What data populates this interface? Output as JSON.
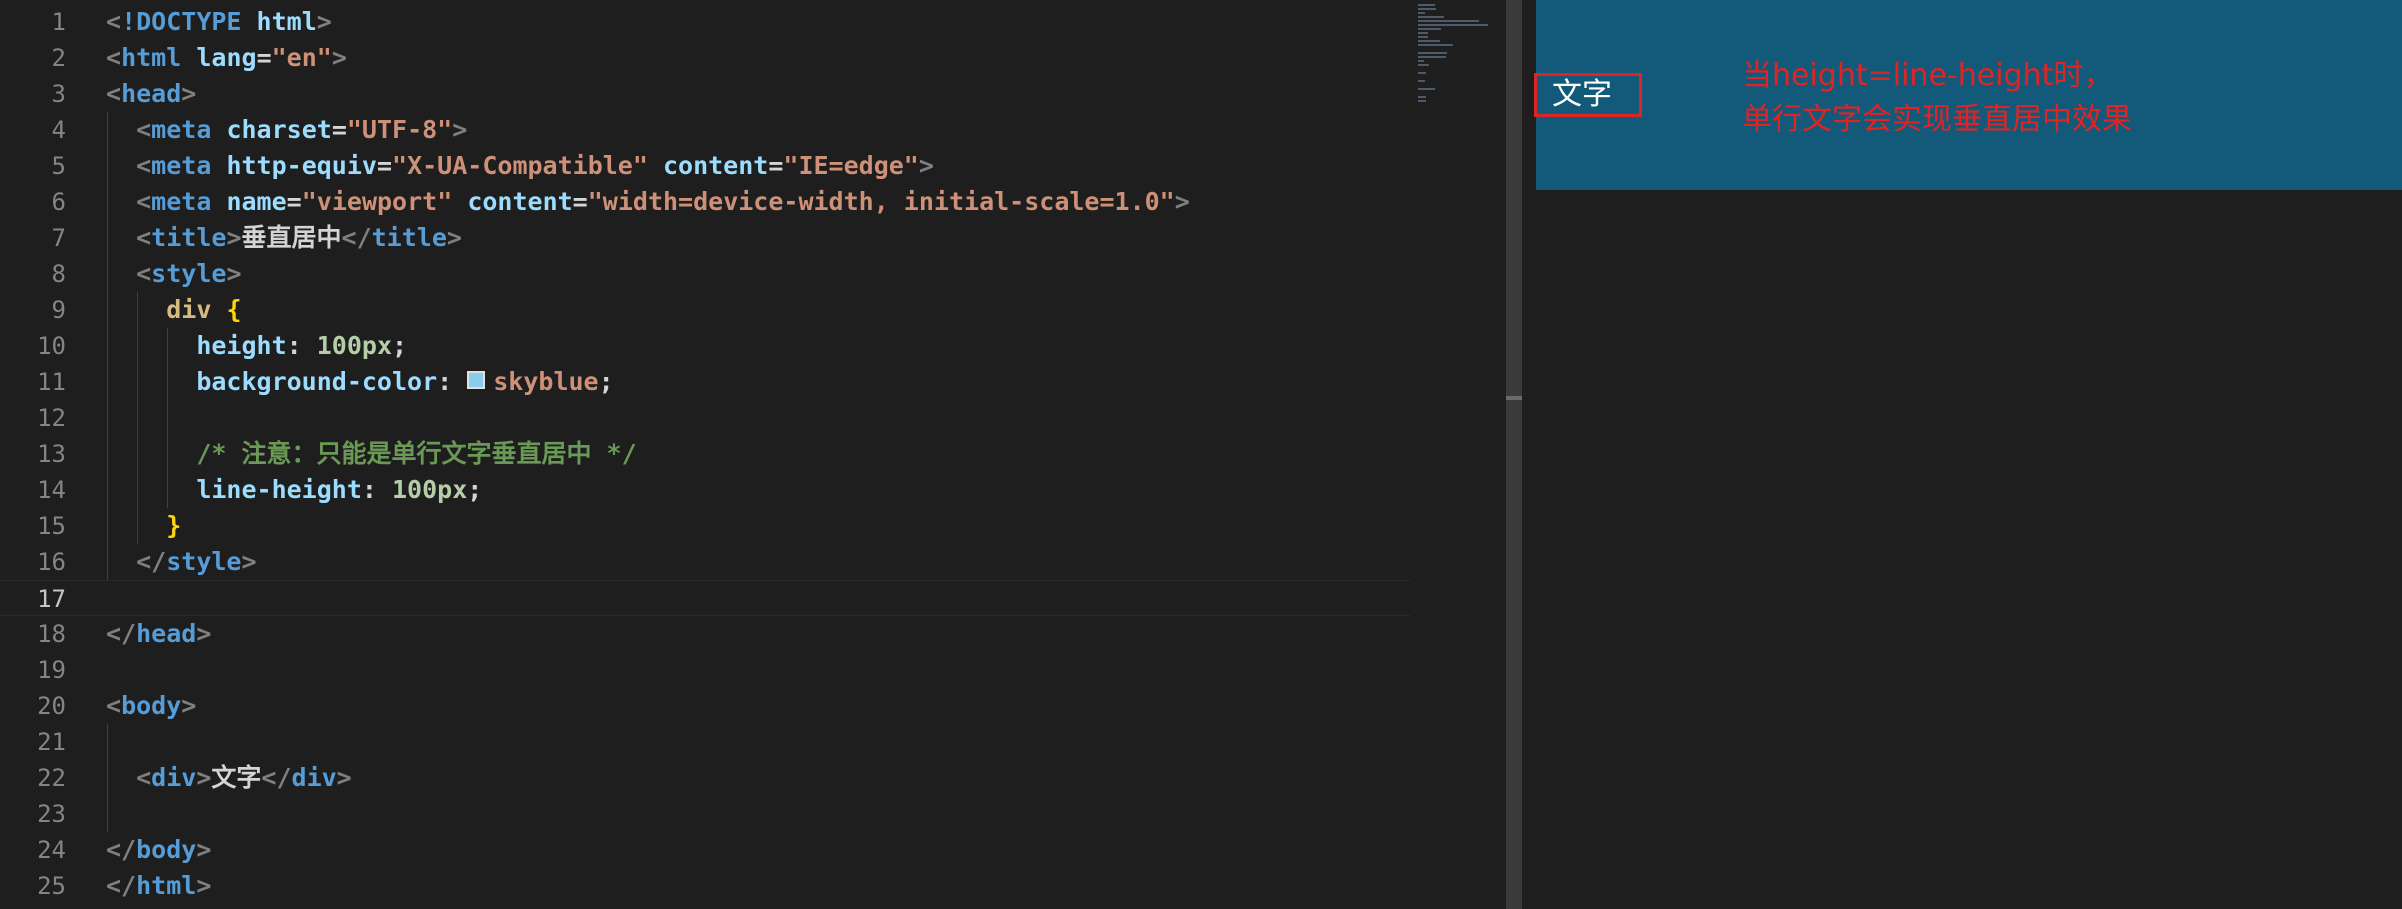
{
  "editor": {
    "line_numbers": [
      "1",
      "2",
      "3",
      "4",
      "5",
      "6",
      "7",
      "8",
      "9",
      "10",
      "11",
      "12",
      "13",
      "14",
      "15",
      "16",
      "17",
      "18",
      "19",
      "20",
      "21",
      "22",
      "23",
      "24",
      "25"
    ],
    "active_line": 17,
    "lines": [
      [
        [
          "t-punc",
          "<"
        ],
        [
          "t-tag",
          "!DOCTYPE"
        ],
        [
          "t-text",
          " "
        ],
        [
          "t-attr",
          "html"
        ],
        [
          "t-punc",
          ">"
        ]
      ],
      [
        [
          "t-punc",
          "<"
        ],
        [
          "t-tag",
          "html"
        ],
        [
          "t-text",
          " "
        ],
        [
          "t-attr",
          "lang"
        ],
        [
          "t-text",
          "="
        ],
        [
          "t-str",
          "\"en\""
        ],
        [
          "t-punc",
          ">"
        ]
      ],
      [
        [
          "t-punc",
          "<"
        ],
        [
          "t-tag",
          "head"
        ],
        [
          "t-punc",
          ">"
        ]
      ],
      [
        [
          "t-text",
          "  "
        ],
        [
          "t-punc",
          "<"
        ],
        [
          "t-tag",
          "meta"
        ],
        [
          "t-text",
          " "
        ],
        [
          "t-attr",
          "charset"
        ],
        [
          "t-text",
          "="
        ],
        [
          "t-str",
          "\"UTF-8\""
        ],
        [
          "t-punc",
          ">"
        ]
      ],
      [
        [
          "t-text",
          "  "
        ],
        [
          "t-punc",
          "<"
        ],
        [
          "t-tag",
          "meta"
        ],
        [
          "t-text",
          " "
        ],
        [
          "t-attr",
          "http-equiv"
        ],
        [
          "t-text",
          "="
        ],
        [
          "t-str",
          "\"X-UA-Compatible\""
        ],
        [
          "t-text",
          " "
        ],
        [
          "t-attr",
          "content"
        ],
        [
          "t-text",
          "="
        ],
        [
          "t-str",
          "\"IE=edge\""
        ],
        [
          "t-punc",
          ">"
        ]
      ],
      [
        [
          "t-text",
          "  "
        ],
        [
          "t-punc",
          "<"
        ],
        [
          "t-tag",
          "meta"
        ],
        [
          "t-text",
          " "
        ],
        [
          "t-attr",
          "name"
        ],
        [
          "t-text",
          "="
        ],
        [
          "t-str",
          "\"viewport\""
        ],
        [
          "t-text",
          " "
        ],
        [
          "t-attr",
          "content"
        ],
        [
          "t-text",
          "="
        ],
        [
          "t-str",
          "\"width=device-width, initial-scale=1.0\""
        ],
        [
          "t-punc",
          ">"
        ]
      ],
      [
        [
          "t-text",
          "  "
        ],
        [
          "t-punc",
          "<"
        ],
        [
          "t-tag",
          "title"
        ],
        [
          "t-punc",
          ">"
        ],
        [
          "t-text",
          "垂直居中"
        ],
        [
          "t-punc",
          "</"
        ],
        [
          "t-tag",
          "title"
        ],
        [
          "t-punc",
          ">"
        ]
      ],
      [
        [
          "t-text",
          "  "
        ],
        [
          "t-punc",
          "<"
        ],
        [
          "t-tag",
          "style"
        ],
        [
          "t-punc",
          ">"
        ]
      ],
      [
        [
          "t-text",
          "    "
        ],
        [
          "t-sel",
          "div"
        ],
        [
          "t-text",
          " "
        ],
        [
          "t-brace",
          "{"
        ]
      ],
      [
        [
          "t-text",
          "      "
        ],
        [
          "t-prop",
          "height"
        ],
        [
          "t-text",
          ": "
        ],
        [
          "t-num",
          "100px"
        ],
        [
          "t-text",
          ";"
        ]
      ],
      [
        [
          "t-text",
          "      "
        ],
        [
          "t-prop",
          "background-color"
        ],
        [
          "t-text",
          ": "
        ],
        [
          "swatch",
          "#87ceeb"
        ],
        [
          "t-str",
          "skyblue"
        ],
        [
          "t-text",
          ";"
        ]
      ],
      [],
      [
        [
          "t-text",
          "      "
        ],
        [
          "t-comment",
          "/* 注意：只能是单行文字垂直居中 */"
        ]
      ],
      [
        [
          "t-text",
          "      "
        ],
        [
          "t-prop",
          "line-height"
        ],
        [
          "t-text",
          ": "
        ],
        [
          "t-num",
          "100px"
        ],
        [
          "t-text",
          ";"
        ]
      ],
      [
        [
          "t-text",
          "    "
        ],
        [
          "t-brace",
          "}"
        ]
      ],
      [
        [
          "t-text",
          "  "
        ],
        [
          "t-punc",
          "</"
        ],
        [
          "t-tag",
          "style"
        ],
        [
          "t-punc",
          ">"
        ]
      ],
      [],
      [
        [
          "t-punc",
          "</"
        ],
        [
          "t-tag",
          "head"
        ],
        [
          "t-punc",
          ">"
        ]
      ],
      [],
      [
        [
          "t-punc",
          "<"
        ],
        [
          "t-tag",
          "body"
        ],
        [
          "t-punc",
          ">"
        ]
      ],
      [],
      [
        [
          "t-text",
          "  "
        ],
        [
          "t-punc",
          "<"
        ],
        [
          "t-tag",
          "div"
        ],
        [
          "t-punc",
          ">"
        ],
        [
          "t-text",
          "文字"
        ],
        [
          "t-punc",
          "</"
        ],
        [
          "t-tag",
          "div"
        ],
        [
          "t-punc",
          ">"
        ]
      ],
      [],
      [
        [
          "t-punc",
          "</"
        ],
        [
          "t-tag",
          "body"
        ],
        [
          "t-punc",
          ">"
        ]
      ],
      [
        [
          "t-punc",
          "</"
        ],
        [
          "t-tag",
          "html"
        ],
        [
          "t-punc",
          ">"
        ]
      ]
    ]
  },
  "preview": {
    "div_text": "文字",
    "background_color": "#135a7a",
    "annotation_line1": "当height=line-height时，",
    "annotation_line2": "单行文字会实现垂直居中效果",
    "annotation_color": "#e02424"
  }
}
